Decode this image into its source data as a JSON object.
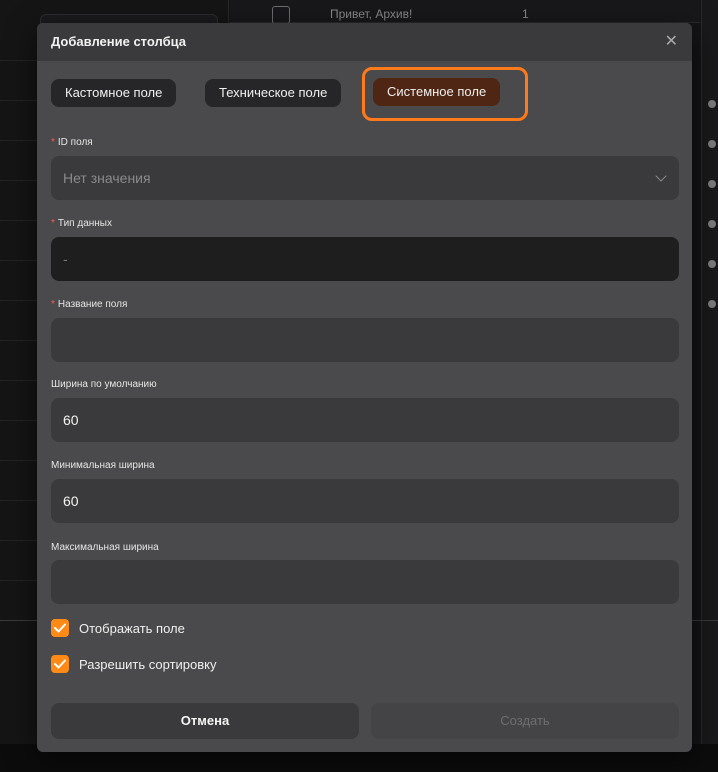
{
  "background": {
    "row_label": "Привет, Архив!",
    "row_number": "1"
  },
  "modal": {
    "title": "Добавление столбца",
    "close_icon": "close-icon",
    "tabs": [
      {
        "label": "Кастомное поле",
        "active": false
      },
      {
        "label": "Техническое поле",
        "active": false
      },
      {
        "label": "Системное поле",
        "active": true
      }
    ],
    "fields": {
      "id": {
        "label": "ID поля",
        "required": true,
        "placeholder": "Нет значения"
      },
      "data_type": {
        "label": "Тип данных",
        "required": true,
        "value": "-"
      },
      "name": {
        "label": "Название поля",
        "required": true,
        "value": ""
      },
      "default_width": {
        "label": "Ширина по умолчанию",
        "value": "60"
      },
      "min_width": {
        "label": "Минимальная ширина",
        "value": "60"
      },
      "max_width": {
        "label": "Максимальная ширина",
        "value": ""
      }
    },
    "checkboxes": {
      "show_field": {
        "label": "Отображать поле",
        "checked": true
      },
      "allow_sort": {
        "label": "Разрешить сортировку",
        "checked": true
      }
    },
    "buttons": {
      "cancel": "Отмена",
      "create": "Создать"
    }
  },
  "colors": {
    "accent": "#ff8a16",
    "active_tab": "#4e2613",
    "highlight": "#ff7a1a",
    "required": "#ff5a4d"
  }
}
